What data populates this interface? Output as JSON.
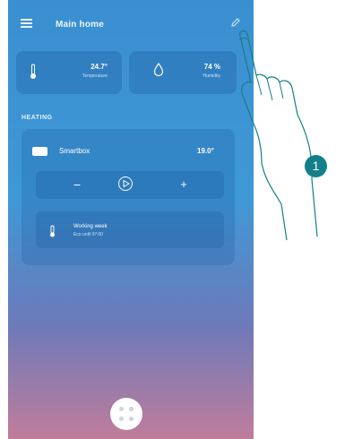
{
  "header": {
    "title": "Main home",
    "menu_icon": "hamburger-menu-icon",
    "edit_icon": "edit-pencil-icon"
  },
  "sensors": {
    "temperature": {
      "value": "24.7°",
      "label": "Temperature",
      "icon": "thermometer-icon"
    },
    "humidity": {
      "value": "74 %",
      "label": "Humidity",
      "icon": "water-drop-icon"
    }
  },
  "section": {
    "label": "HEATING"
  },
  "room": {
    "name": "Smartbox",
    "temperature": "19.0°",
    "controls": {
      "minus_label": "−",
      "plus_label": "+"
    },
    "mode": {
      "title": "Working week",
      "subtitle": "Eco until 07:00"
    }
  },
  "fab": {
    "icon": "apps-grid-icon"
  },
  "callout": {
    "number": "1"
  },
  "colors": {
    "accent": "#3a8fd0",
    "callout": "#137f89"
  }
}
